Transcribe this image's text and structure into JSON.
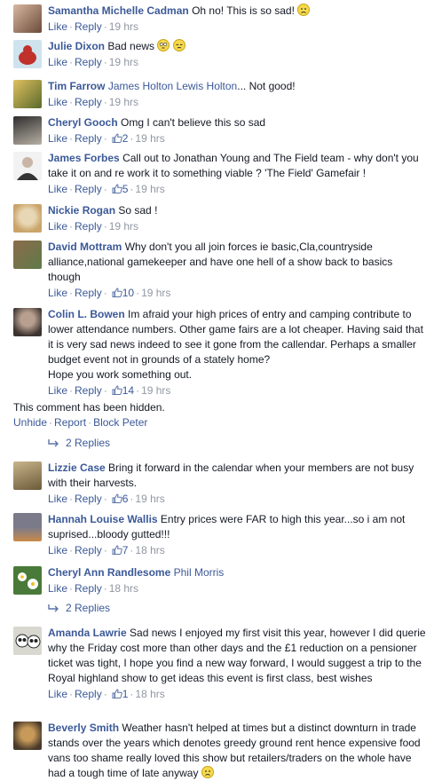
{
  "actions": {
    "like": "Like",
    "reply": "Reply",
    "sep": "·"
  },
  "comments": [
    {
      "name": "Samantha Michelle Cadman",
      "text": "Oh no! This is so sad!",
      "emoji": [
        "frown-emoji"
      ],
      "likes": "",
      "time": "19 hrs",
      "avatar_colors": [
        "#c9a88a",
        "#6b4a3a"
      ]
    },
    {
      "name": "Julie Dixon",
      "text": "Bad news",
      "emoji": [
        "flushed-emoji",
        "relieved-emoji"
      ],
      "likes": "",
      "time": "19 hrs",
      "avatar_colors": [
        "#cfe3ee",
        "#c0312b"
      ]
    },
    {
      "name": "Tim Farrow",
      "mentions": [
        "James Holton",
        "Lewis Holton"
      ],
      "text": "... Not good!",
      "likes": "",
      "time": "19 hrs",
      "avatar_colors": [
        "#d9b85a",
        "#5a6a2a"
      ]
    },
    {
      "name": "Cheryl Gooch",
      "text": "Omg I can't believe this so sad",
      "likes": "2",
      "time": "19 hrs",
      "avatar_colors": [
        "#3a3a3a",
        "#b8b0a5"
      ]
    },
    {
      "name": "James Forbes",
      "text": "Call out to Jonathan Young and The Field team - why don't you take it on and re work it to something viable ? 'The Field' Gamefair !",
      "likes": "5",
      "time": "19 hrs",
      "avatar_colors": [
        "#f0f0f0",
        "#333333"
      ]
    },
    {
      "name": "Nickie Rogan",
      "text": "So sad !",
      "likes": "",
      "time": "19 hrs",
      "avatar_colors": [
        "#caa46a",
        "#e8d7b5"
      ]
    },
    {
      "name": "David Mottram",
      "text": "Why don't you all join forces ie basic,Cla,countryside alliance,national gamekeeper and have one hell of a show back to basics though",
      "likes": "10",
      "time": "19 hrs",
      "avatar_colors": [
        "#5f7a4a",
        "#8c6b4a"
      ]
    },
    {
      "name": "Colin L. Bowen",
      "text": "Im afraid your high prices of entry and camping contribute to lower attendance numbers. Other game fairs are a lot cheaper. Having said that it is very sad news indeed to see it gone from the callendar. Perhaps a smaller budget event not in grounds of a stately home?\nHope you work something out.",
      "likes": "14",
      "time": "19 hrs",
      "avatar_colors": [
        "#8a7b70",
        "#3d3430"
      ]
    }
  ],
  "hidden": {
    "text": "This comment has been hidden.",
    "unhide": "Unhide",
    "report": "Report",
    "block": "Block Peter"
  },
  "replies1": "2 Replies",
  "comments2": [
    {
      "name": "Lizzie Case",
      "text": "Bring it forward in the calendar when your members are not busy with their harvests.",
      "likes": "6",
      "time": "19 hrs",
      "avatar_colors": [
        "#a8956a",
        "#6b5a3a"
      ]
    },
    {
      "name": "Hannah Louise Wallis",
      "text": "Entry prices were FAR to high this year...so i am not suprised...bloody gutted!!!",
      "likes": "7",
      "time": "18 hrs",
      "avatar_colors": [
        "#7a7a8a",
        "#c98a4a"
      ]
    },
    {
      "name": "Cheryl Ann Randlesome",
      "mentions": [
        "Phil Morris"
      ],
      "text": "",
      "likes": "",
      "time": "18 hrs",
      "avatar_colors": [
        "#4a7a3a",
        "#ffffff"
      ]
    }
  ],
  "replies2": "2 Replies",
  "comments3": [
    {
      "name": "Amanda Lawrie",
      "text": "Sad news I enjoyed my first visit this year, however I did querie why the Friday cost more than other days and the £1 reduction on a pensioner ticket was tight, I hope you find a new way forward, I would suggest a trip to the Royal highland show to get ideas this event is first class, best wishes",
      "likes": "1",
      "time": "18 hrs",
      "avatar_colors": [
        "#d8d8d0",
        "#222222"
      ]
    },
    {
      "name": "Beverly Smith",
      "text": "Weather hasn't helped at times but a distinct downturn in trade stands over the years which denotes greedy ground rent hence expensive food vans too shame really loved this show but retailers/traders on the whole have had a tough time of late anyway",
      "emoji": [
        "frown-emoji"
      ],
      "likes": "",
      "time": "",
      "avatar_colors": [
        "#8a6a3a",
        "#4a3a2a"
      ]
    }
  ]
}
